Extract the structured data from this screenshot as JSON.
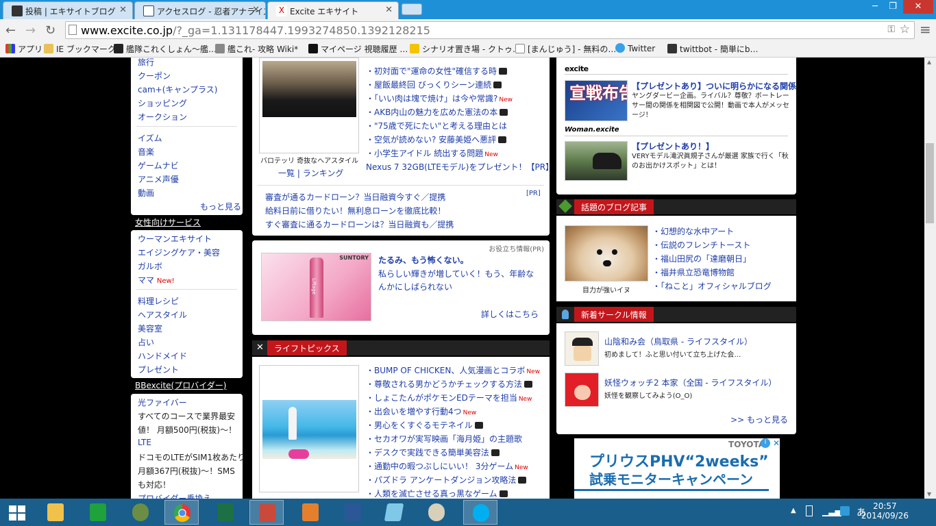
{
  "tabs": [
    {
      "label": "投稿 | エキサイトブログ"
    },
    {
      "label": "アクセスログ - 忍者アナライズ"
    },
    {
      "label": "Excite エキサイト"
    }
  ],
  "window_controls": {
    "minimize": "─",
    "restore": "❐",
    "close": "✕"
  },
  "toolbar": {
    "back": "←",
    "forward": "→",
    "reload": "↻",
    "url_host": "www.excite.co.jp",
    "url_rest": "/?_ga=1.131178447.1993274850.1392128215",
    "menu": "≡"
  },
  "bookmarks": [
    "アプリ",
    "IE ブックマーク",
    "艦隊これくしょん～艦…",
    "艦これ- 攻略 Wiki*",
    "マイページ 視聴履歴 …",
    "シナリオ置き場 - クトゥ…",
    "[まんじゅう] - 無料の…",
    "Twitter",
    "twittbot - 簡単にb…"
  ],
  "sidebar": {
    "group1": [
      "旅行",
      "クーポン",
      "cam+(キャンプラス)",
      "ショッピング",
      "オークション"
    ],
    "group2": [
      "イズム",
      "音楽",
      "ゲームナビ",
      "アニメ声優",
      "動画"
    ],
    "more": "もっと見る",
    "women_header": "女性向けサービス",
    "group3": [
      "ウーマンエキサイト",
      "エイジングケア・美容",
      "ガルボ",
      "ママ"
    ],
    "mama_new": "New!",
    "group4": [
      "料理レシピ",
      "ヘアスタイル",
      "美容室",
      "占い",
      "ハンドメイド",
      "プレゼント"
    ],
    "bb_header": "BBexcite(プロバイダー)",
    "bb_items": [
      "光ファイバー",
      "すべてのコースで業界最安",
      "値！ 月額500円(税抜)～！",
      "LTE",
      "ドコモのLTEがSIM1枚あたり",
      "月額367円(税抜)～！SMS",
      "も対応！",
      "プロバイダー乗換え"
    ]
  },
  "top_news": {
    "caption": "バロテッリ 奇抜なヘアスタイル",
    "caption_links": [
      "一覧",
      "ランキング"
    ],
    "items": [
      {
        "text": "・初対面で\"運命の女性\"確信する時",
        "cam": true,
        "new": false
      },
      {
        "text": "・屋飯最終回 びっくりシーン連続",
        "cam": true,
        "new": false
      },
      {
        "text": "・「いい肉は塊で焼け」は今や常識?",
        "cam": false,
        "new": true
      },
      {
        "text": "・AKB内山の魅力を広めた憲法の本",
        "cam": true,
        "new": false
      },
      {
        "text": "・\"75歳で死にたい\"と考える理由とは",
        "cam": false,
        "new": false
      },
      {
        "text": "・空気が読めない? 安藤美姫へ悪評",
        "cam": true,
        "new": false
      },
      {
        "text": "・小学生アイドル 続出する問題",
        "cam": false,
        "new": true
      }
    ],
    "promo": "Nexus 7 32GB(LTEモデル)をプレゼント！【PR】",
    "new_label": "New"
  },
  "pr_links": {
    "pr_tag": "[PR]",
    "items": [
      "審査が通るカードローン？当日融資今すぐ／提携",
      "給料日前に借りたい！無利息ローンを徹底比較！",
      "すぐ審査に通るカードローンは？当日融資も／提携"
    ]
  },
  "ad": {
    "tag": "お役立ち情報(PR)",
    "brand": "SUNTORY",
    "bottle_label": "Liftage",
    "title": "たるみ、もう怖くない。",
    "body": "私らしい輝きが増していく！もう、年齢なんかにしばられない",
    "more": "詳しくはこちら"
  },
  "lifetopics": {
    "header": "ライフトピックス",
    "items": [
      {
        "text": "・BUMP OF CHICKEN、人気漫画とコラボ",
        "cam": false,
        "new": true
      },
      {
        "text": "・尊敬される男かどうかチェックする方法",
        "cam": true,
        "new": false
      },
      {
        "text": "・しょこたんがポケモンEDテーマを担当",
        "cam": false,
        "new": true
      },
      {
        "text": "・出会いを増やす行動4つ",
        "cam": false,
        "new": true
      },
      {
        "text": "・男心をくすぐるモテネイル",
        "cam": true,
        "new": false
      },
      {
        "text": "・セカオワが実写映画「海月姫」の主題歌",
        "cam": false,
        "new": false
      },
      {
        "text": "・デスクで実践できる簡単美容法",
        "cam": true,
        "new": false
      },
      {
        "text": "・通勤中の暇つぶしにいい！ 3分ゲーム",
        "cam": false,
        "new": true
      },
      {
        "text": "・パズドラ アンケートダンジョン攻略法",
        "cam": true,
        "new": false
      },
      {
        "text": "・人類を滅亡させる真っ黒なゲーム",
        "cam": true,
        "new": false
      }
    ]
  },
  "right_col": {
    "excite_logo": "excite",
    "item1_title": "【プレゼントあり】ついに明らかになる関係",
    "item1_body": "ヤングダービー企画。ライバル？尊敬？ボートレーサー間の関係を相関図で公開！動画で本人がメッセージ！",
    "item1_img": "宣戦布告!",
    "woman_logo": "Woman.excite",
    "item2_title": "【プレゼントあり！】",
    "item2_body": "VERYモデル滝沢眞規子さんが厳選 家族で行く「秋のお出かけスポット」とは！",
    "blog_header": "話題のブログ記事",
    "blog_caption": "目力が強いイヌ",
    "blog_items": [
      "・幻想的な水中アート",
      "・伝説のフレンチトースト",
      "・福山田尻の「達磨朝日」",
      "・福井県立恐竜博物館",
      "・「ねこと」オフィシャルブログ"
    ],
    "circle_header": "新着サークル情報",
    "circles": [
      {
        "title": "山陰和み会（鳥取県 - ライフスタイル）",
        "desc": "初めまして！ふと思い付いて立ち上げた会…"
      },
      {
        "title": "妖怪ウォッチ2 本家（全国 - ライフスタイル）",
        "desc": "妖怪を観察してみよう(O_O)"
      }
    ],
    "circle_more": ">> もっと見る",
    "banner_brand": "TOYOTA",
    "banner_line1": "プリウスPHV“2weeks”",
    "banner_line2": "試乗モニターキャンペーン"
  },
  "taskbar": {
    "time": "20:57",
    "date": "2014/09/26",
    "ime": "あ"
  }
}
